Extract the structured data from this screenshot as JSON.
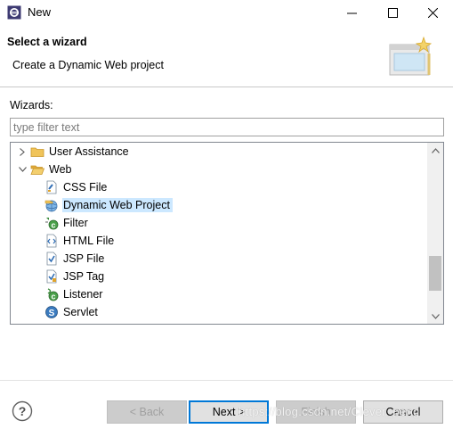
{
  "window": {
    "title": "New"
  },
  "header": {
    "title": "Select a wizard",
    "description": "Create a Dynamic Web project"
  },
  "wizards_label": "Wizards:",
  "filter": {
    "placeholder": "type filter text",
    "value": ""
  },
  "tree": [
    {
      "label": "User Assistance",
      "icon": "folder-icon",
      "level": 0,
      "twistie": "collapsed"
    },
    {
      "label": "Web",
      "icon": "folder-open-icon",
      "level": 0,
      "twistie": "expanded"
    },
    {
      "label": "CSS File",
      "icon": "css-file-icon",
      "level": 1
    },
    {
      "label": "Dynamic Web Project",
      "icon": "web-project-icon",
      "level": 1,
      "selected": true
    },
    {
      "label": "Filter",
      "icon": "filter-icon",
      "level": 1
    },
    {
      "label": "HTML File",
      "icon": "html-file-icon",
      "level": 1
    },
    {
      "label": "JSP File",
      "icon": "jsp-file-icon",
      "level": 1
    },
    {
      "label": "JSP Tag",
      "icon": "jsp-tag-icon",
      "level": 1
    },
    {
      "label": "Listener",
      "icon": "listener-icon",
      "level": 1
    },
    {
      "label": "Servlet",
      "icon": "servlet-icon",
      "level": 1
    }
  ],
  "buttons": {
    "back": {
      "label": "< Back",
      "enabled": false
    },
    "next": {
      "label": "Next >",
      "enabled": true
    },
    "finish": {
      "label": "Finish",
      "enabled": false
    },
    "cancel": {
      "label": "Cancel",
      "enabled": true
    }
  },
  "watermark": "https://blog.csdn.net/Clever_peng",
  "colors": {
    "selection": "#cce8ff",
    "default_button_border": "#0078d7",
    "folder": "#e8b64a"
  }
}
